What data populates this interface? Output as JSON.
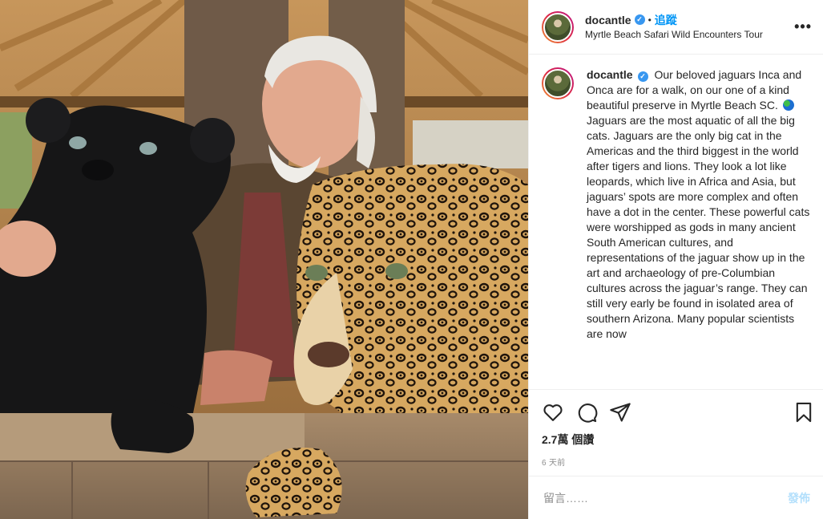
{
  "photo": {
    "alt": "Man with a black jaguar and a spotted jaguar"
  },
  "header": {
    "username": "docantle",
    "verified_icon": "verified-badge-icon",
    "separator": "•",
    "follow_label": "追蹤",
    "location": "Myrtle Beach Safari Wild Encounters Tour",
    "more_icon": "more-options-icon",
    "more_label": "•••"
  },
  "caption": {
    "username": "docantle",
    "text_before_globe": "Our beloved jaguars Inca and Onca are for a walk, on our one of a kind beautiful preserve in Myrtle Beach SC.",
    "text_after_globe": "Jaguars are the most aquatic of all the big cats. Jaguars are the only big cat in the Americas and the third biggest in the world after tigers and lions. They look a lot like leopards, which live in Africa and Asia, but jaguars’ spots are more complex and often have a dot in the center. These powerful cats were worshipped as gods in many ancient South American cultures, and representations of the jaguar show up in the art and archaeology of pre-Columbian cultures across the jaguar’s range. They can still very early be found in isolated area of southern Arizona. Many popular scientists are now"
  },
  "actions": {
    "like_icon": "heart-icon",
    "comment_icon": "comment-icon",
    "share_icon": "share-icon",
    "save_icon": "bookmark-icon"
  },
  "stats": {
    "likes": "2.7萬 個讚",
    "time": "6 天前"
  },
  "comment_box": {
    "placeholder": "留言……",
    "post_label": "發佈"
  },
  "colors": {
    "accent": "#0095f6",
    "post_disabled": "#b2dffc",
    "border": "#efefef",
    "muted": "#8e8e8e"
  }
}
